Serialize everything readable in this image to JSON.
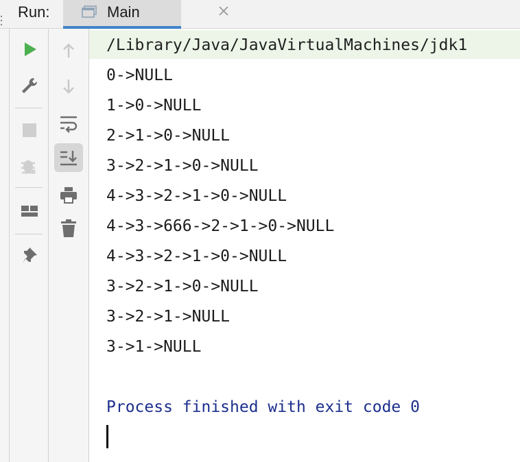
{
  "header": {
    "run_label": "Run:",
    "tab_label": "Main"
  },
  "colors": {
    "accent": "#4083c9",
    "run_green": "#4caf50",
    "process_text": "#1c2f8c",
    "cmd_background": "#edf5e8"
  },
  "toolbar_left": [
    {
      "icon": "play-icon"
    },
    {
      "icon": "wrench-icon"
    },
    {
      "icon": "stop-icon"
    },
    {
      "icon": "debug-icon"
    },
    {
      "icon": "layout-icon"
    },
    {
      "icon": "pin-icon"
    }
  ],
  "toolbar_right": [
    {
      "icon": "arrow-up-icon"
    },
    {
      "icon": "arrow-down-icon"
    },
    {
      "icon": "soft-wrap-icon"
    },
    {
      "icon": "scroll-to-end-icon"
    },
    {
      "icon": "print-icon"
    },
    {
      "icon": "trash-icon"
    }
  ],
  "console": {
    "command": "/Library/Java/JavaVirtualMachines/jdk1",
    "output": [
      "0->NULL",
      "1->0->NULL",
      "2->1->0->NULL",
      "3->2->1->0->NULL",
      "4->3->2->1->0->NULL",
      "4->3->666->2->1->0->NULL",
      "4->3->2->1->0->NULL",
      "3->2->1->0->NULL",
      "3->2->1->NULL",
      "3->1->NULL"
    ],
    "process_message": "Process finished with exit code 0"
  }
}
